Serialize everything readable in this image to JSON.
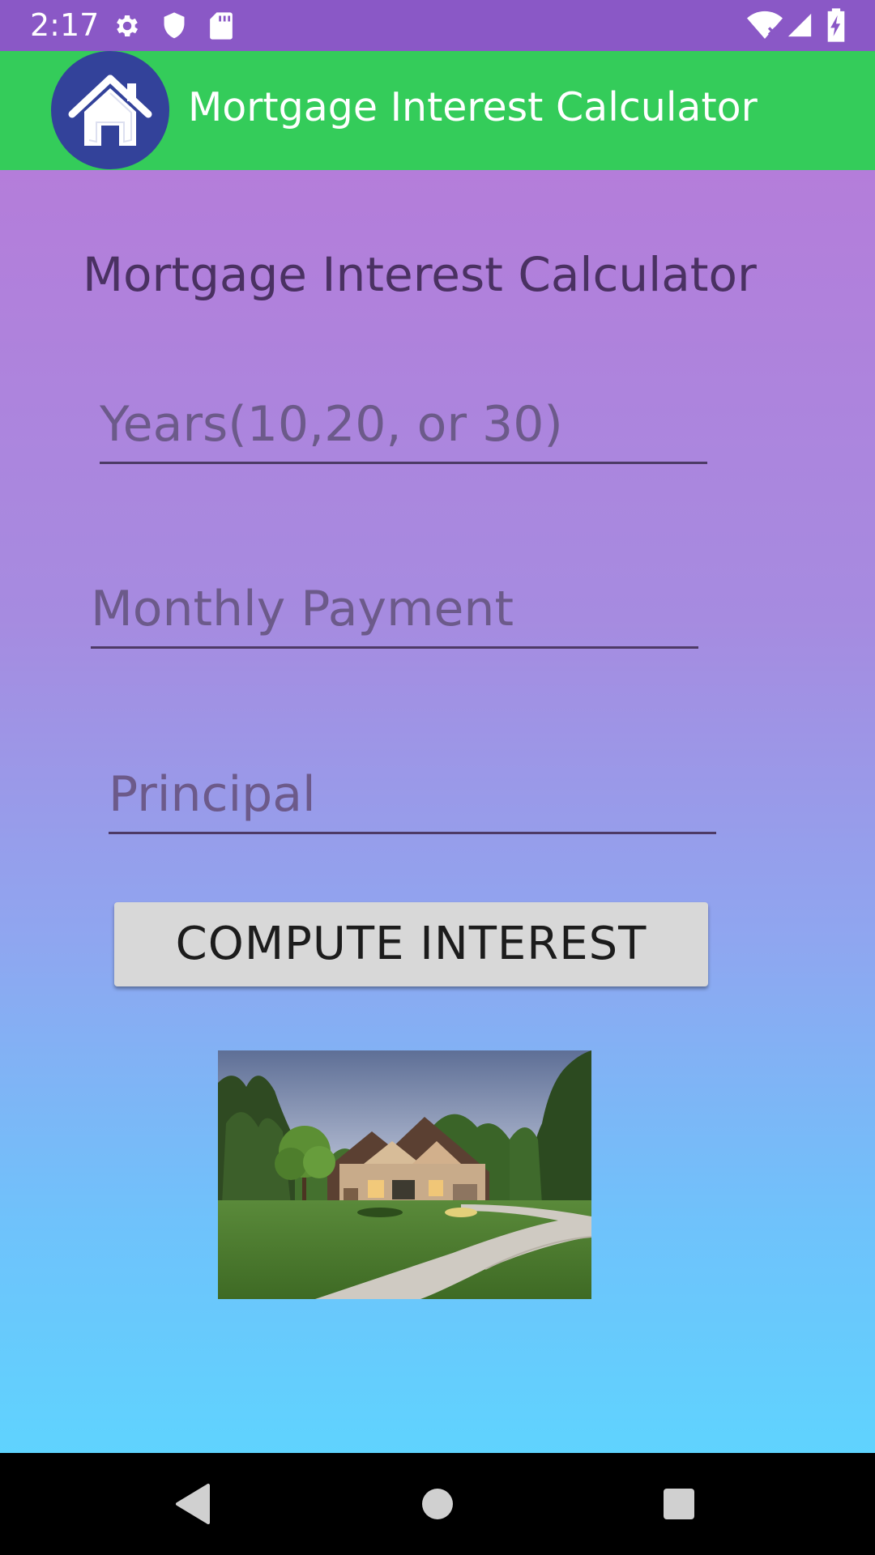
{
  "status_bar": {
    "time": "2:17",
    "icons": [
      "gear-icon",
      "shield-icon",
      "sd-card-icon",
      "wifi-icon",
      "signal-icon",
      "battery-charging-icon"
    ]
  },
  "app_bar": {
    "title": "Mortgage Interest Calculator",
    "logo_icon": "house-icon",
    "logo_color": "#33429a",
    "background": "#34cc5a"
  },
  "main": {
    "heading": "Mortgage Interest Calculator",
    "years_field": {
      "placeholder": "Years(10,20, or 30)",
      "value": ""
    },
    "monthly_payment_field": {
      "placeholder": "Monthly Payment",
      "value": ""
    },
    "principal_field": {
      "placeholder": "Principal",
      "value": ""
    },
    "compute_button_label": "COMPUTE INTEREST",
    "image": "house-photo"
  },
  "nav_bar": {
    "buttons": [
      "back-icon",
      "home-icon",
      "recents-icon"
    ]
  }
}
